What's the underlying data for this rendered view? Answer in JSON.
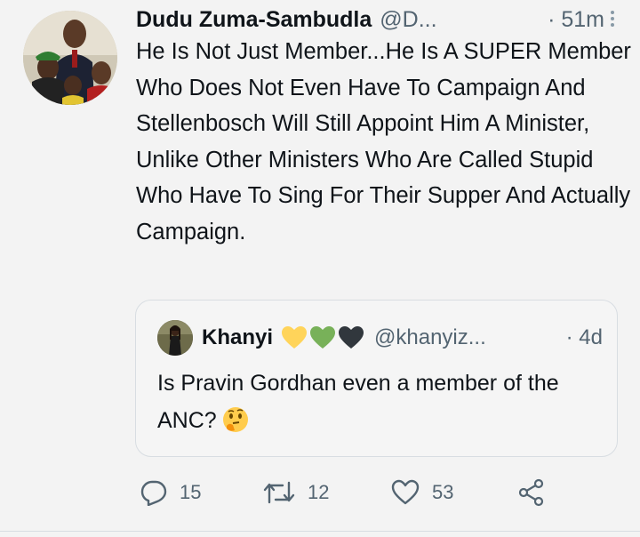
{
  "tweet": {
    "display_name": "Dudu Zuma-Sambudla",
    "handle": "@D...",
    "time": "· 51m",
    "text": "He Is Not Just Member...He Is A SUPER Member Who Does Not Even Have To Campaign And Stellenbosch Will Still Appoint Him A Minister, Unlike Other Ministers Who Are Called Stupid Who Have To Sing For Their Supper And Actually Campaign."
  },
  "quoted_tweet": {
    "display_name": "Khanyi",
    "hearts": [
      "#ffd45a",
      "#78b159",
      "#31373d"
    ],
    "handle": "@khanyiz...",
    "time": "· 4d",
    "text": "Is Pravin Gordhan even a member of the ANC?",
    "emoji": "thinking-face"
  },
  "actions": {
    "replies": "15",
    "retweets": "12",
    "likes": "53",
    "share_icon": "share-icon"
  },
  "colors": {
    "text": "#0f1419",
    "secondary": "#536471",
    "border": "#d8dde2",
    "background": "#f3f3f3"
  }
}
